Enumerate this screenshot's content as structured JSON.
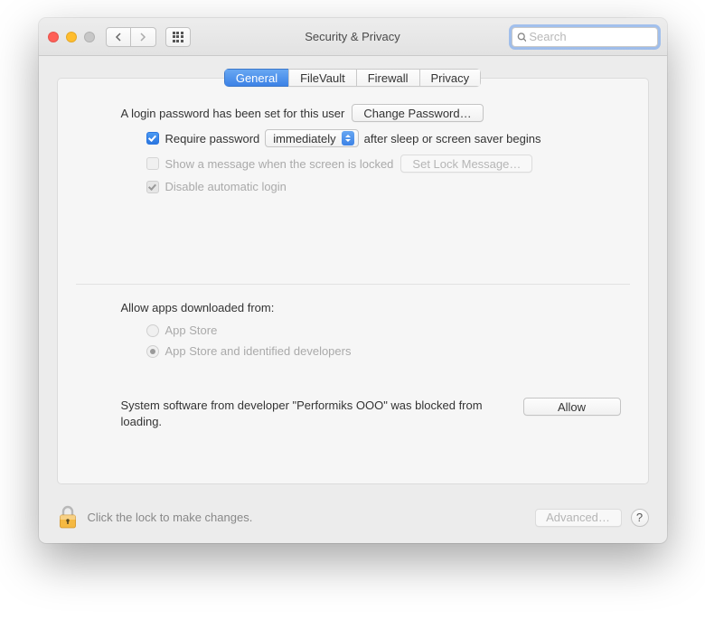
{
  "window": {
    "title": "Security & Privacy",
    "search_placeholder": "Search"
  },
  "tabs": {
    "general": "General",
    "filevault": "FileVault",
    "firewall": "Firewall",
    "privacy": "Privacy"
  },
  "login": {
    "password_set_text": "A login password has been set for this user",
    "change_password_btn": "Change Password…",
    "require_password_label": "Require password",
    "require_password_select": "immediately",
    "require_password_suffix": "after sleep or screen saver begins",
    "show_message_label": "Show a message when the screen is locked",
    "set_lock_message_btn": "Set Lock Message…",
    "disable_auto_login_label": "Disable automatic login"
  },
  "downloads": {
    "section_label": "Allow apps downloaded from:",
    "option_appstore": "App Store",
    "option_identified": "App Store and identified developers"
  },
  "blocked": {
    "text": "System software from developer \"Performiks OOO\" was blocked from loading.",
    "allow_btn": "Allow"
  },
  "footer": {
    "lock_text": "Click the lock to make changes.",
    "advanced_btn": "Advanced…",
    "help": "?"
  }
}
